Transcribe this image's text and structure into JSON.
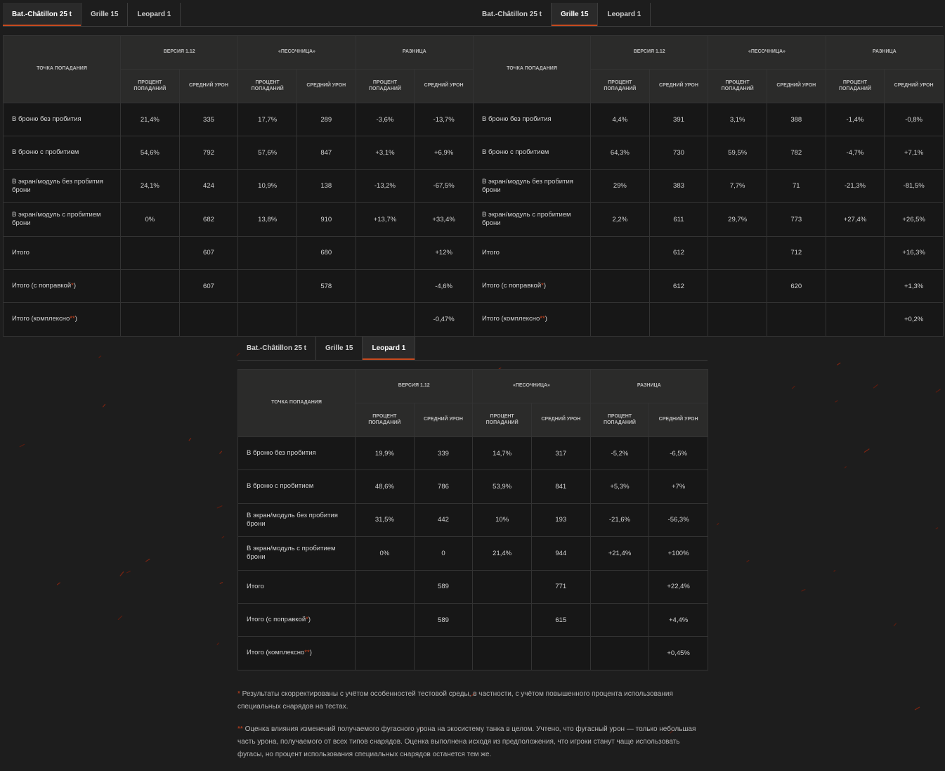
{
  "headers": {
    "hit_point": "Точка попадания",
    "groups": [
      "Версия 1.12",
      "«Песочница»",
      "Разница"
    ],
    "hit_percent": "Процент попаданий",
    "avg_damage": "Средний урон"
  },
  "colors": {
    "background": "#1d1d1d",
    "accent": "#c84a1e"
  },
  "panels": [
    {
      "tabs": [
        "Bat.-Châtillon 25 t",
        "Grille 15",
        "Leopard 1"
      ],
      "active_tab": 0,
      "rows": [
        {
          "label": "В броню без пробития",
          "star": "",
          "cells": [
            "21,4%",
            "335",
            "17,7%",
            "289",
            "-3,6%",
            "-13,7%"
          ]
        },
        {
          "label": "В броню с пробитием",
          "star": "",
          "cells": [
            "54,6%",
            "792",
            "57,6%",
            "847",
            "+3,1%",
            "+6,9%"
          ]
        },
        {
          "label": "В экран/модуль без пробития брони",
          "star": "",
          "cells": [
            "24,1%",
            "424",
            "10,9%",
            "138",
            "-13,2%",
            "-67,5%"
          ]
        },
        {
          "label": "В экран/модуль с пробитием брони",
          "star": "",
          "cells": [
            "0%",
            "682",
            "13,8%",
            "910",
            "+13,7%",
            "+33,4%"
          ]
        },
        {
          "label": "Итого",
          "star": "",
          "cells": [
            "",
            "607",
            "",
            "680",
            "",
            "+12%"
          ]
        },
        {
          "label": "Итого (с поправкой",
          "star": "*",
          "suffix": ")",
          "cells": [
            "",
            "607",
            "",
            "578",
            "",
            "-4,6%"
          ]
        },
        {
          "label": "Итого (комплексно",
          "star": "**",
          "suffix": ")",
          "cells": [
            "",
            "",
            "",
            "",
            "",
            "-0,47%"
          ]
        }
      ]
    },
    {
      "tabs": [
        "Bat.-Châtillon 25 t",
        "Grille 15",
        "Leopard 1"
      ],
      "active_tab": 1,
      "rows": [
        {
          "label": "В броню без пробития",
          "star": "",
          "cells": [
            "4,4%",
            "391",
            "3,1%",
            "388",
            "-1,4%",
            "-0,8%"
          ]
        },
        {
          "label": "В броню с пробитием",
          "star": "",
          "cells": [
            "64,3%",
            "730",
            "59,5%",
            "782",
            "-4,7%",
            "+7,1%"
          ]
        },
        {
          "label": "В экран/модуль без пробития брони",
          "star": "",
          "cells": [
            "29%",
            "383",
            "7,7%",
            "71",
            "-21,3%",
            "-81,5%"
          ]
        },
        {
          "label": "В экран/модуль с пробитием брони",
          "star": "",
          "cells": [
            "2,2%",
            "611",
            "29,7%",
            "773",
            "+27,4%",
            "+26,5%"
          ]
        },
        {
          "label": "Итого",
          "star": "",
          "cells": [
            "",
            "612",
            "",
            "712",
            "",
            "+16,3%"
          ]
        },
        {
          "label": "Итого (с поправкой",
          "star": "*",
          "suffix": ")",
          "cells": [
            "",
            "612",
            "",
            "620",
            "",
            "+1,3%"
          ]
        },
        {
          "label": "Итого (комплексно",
          "star": "**",
          "suffix": ")",
          "cells": [
            "",
            "",
            "",
            "",
            "",
            "+0,2%"
          ]
        }
      ]
    },
    {
      "tabs": [
        "Bat.-Châtillon 25 t",
        "Grille 15",
        "Leopard 1"
      ],
      "active_tab": 2,
      "rows": [
        {
          "label": "В броню без пробития",
          "star": "",
          "cells": [
            "19,9%",
            "339",
            "14,7%",
            "317",
            "-5,2%",
            "-6,5%"
          ]
        },
        {
          "label": "В броню с пробитием",
          "star": "",
          "cells": [
            "48,6%",
            "786",
            "53,9%",
            "841",
            "+5,3%",
            "+7%"
          ]
        },
        {
          "label": "В экран/модуль без пробития брони",
          "star": "",
          "cells": [
            "31,5%",
            "442",
            "10%",
            "193",
            "-21,6%",
            "-56,3%"
          ]
        },
        {
          "label": "В экран/модуль с пробитием брони",
          "star": "",
          "cells": [
            "0%",
            "0",
            "21,4%",
            "944",
            "+21,4%",
            "+100%"
          ]
        },
        {
          "label": "Итого",
          "star": "",
          "cells": [
            "",
            "589",
            "",
            "771",
            "",
            "+22,4%"
          ]
        },
        {
          "label": "Итого (с поправкой",
          "star": "*",
          "suffix": ")",
          "cells": [
            "",
            "589",
            "",
            "615",
            "",
            "+4,4%"
          ]
        },
        {
          "label": "Итого (комплексно",
          "star": "**",
          "suffix": ")",
          "cells": [
            "",
            "",
            "",
            "",
            "",
            "+0,45%"
          ]
        }
      ]
    }
  ],
  "notes": [
    {
      "star": "*",
      "text": " Результаты скорректированы с учётом особенностей тестовой среды, в частности, с учётом повышенного процента использования специальных снарядов на тестах."
    },
    {
      "star": "**",
      "text": " Оценка влияния изменений получаемого фугасного урона на экосистему танка в целом. Учтено, что фугасный урон — только небольшая часть урона, получаемого от всех типов снарядов. Оценка выполнена исходя из предположения, что игроки станут чаще использовать фугасы, но процент использования специальных снарядов останется тем же."
    }
  ]
}
